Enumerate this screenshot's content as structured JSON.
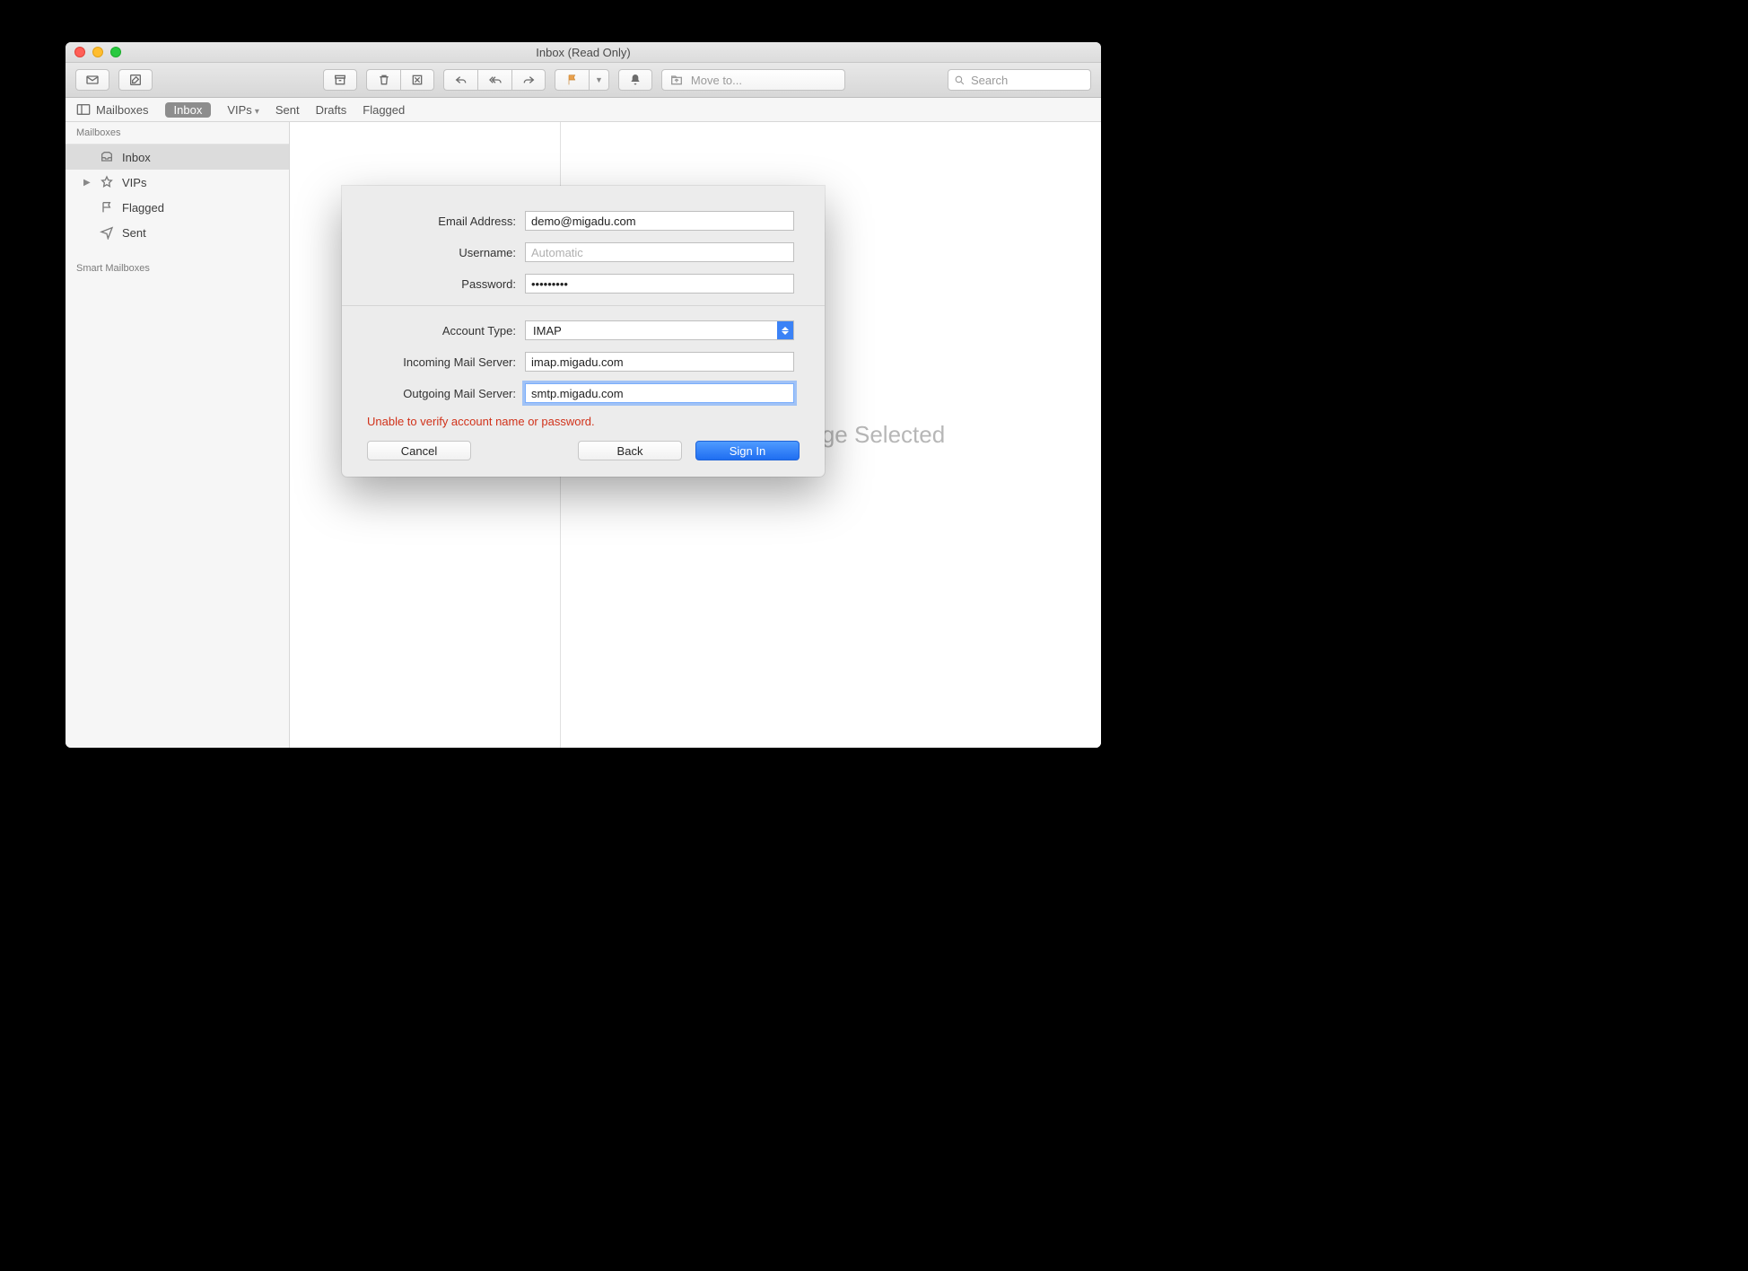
{
  "window": {
    "title": "Inbox (Read Only)"
  },
  "toolbar": {
    "moveto_placeholder": "Move to...",
    "search_placeholder": "Search"
  },
  "favbar": {
    "mailboxes": "Mailboxes",
    "inbox": "Inbox",
    "vips": "VIPs",
    "sent": "Sent",
    "drafts": "Drafts",
    "flagged": "Flagged"
  },
  "sidebar": {
    "section_mailboxes": "Mailboxes",
    "inbox": "Inbox",
    "vips": "VIPs",
    "flagged": "Flagged",
    "sent": "Sent",
    "section_smart": "Smart Mailboxes"
  },
  "msgpane": {
    "empty_msg": "No Message Selected"
  },
  "sheet": {
    "labels": {
      "email": "Email Address:",
      "username": "Username:",
      "password": "Password:",
      "account_type": "Account Type:",
      "incoming": "Incoming Mail Server:",
      "outgoing": "Outgoing Mail Server:"
    },
    "values": {
      "email": "demo@migadu.com",
      "username_placeholder": "Automatic",
      "password": "•••••••••",
      "account_type": "IMAP",
      "incoming": "imap.migadu.com",
      "outgoing": "smtp.migadu.com"
    },
    "error": "Unable to verify account name or password.",
    "buttons": {
      "cancel": "Cancel",
      "back": "Back",
      "signin": "Sign In"
    }
  }
}
